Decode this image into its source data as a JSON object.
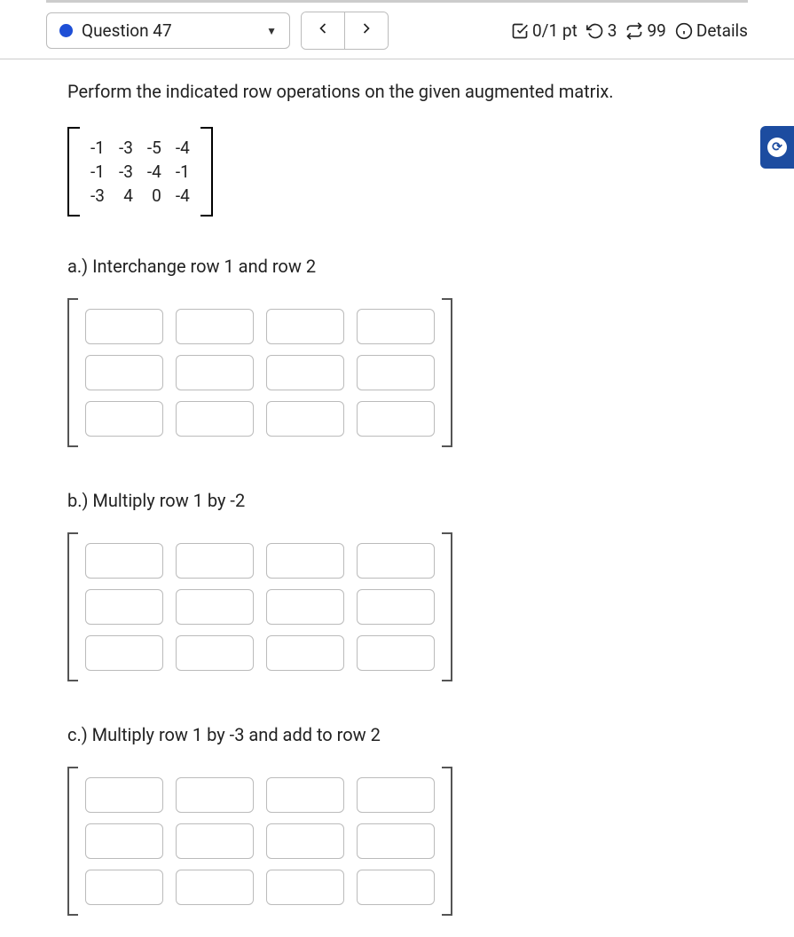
{
  "header": {
    "question_label": "Question 47",
    "score": "0/1 pt",
    "retries": "3",
    "attempts": "99",
    "details_label": "Details"
  },
  "instruction": "Perform the indicated row operations on the given augmented matrix.",
  "matrix": [
    [
      "-1",
      "-3",
      "-5",
      "-4"
    ],
    [
      "-1",
      "-3",
      "-4",
      "-1"
    ],
    [
      "-3",
      "4",
      "0",
      "-4"
    ]
  ],
  "parts": {
    "a": "a.) Interchange row 1 and row 2",
    "b": "b.) Multiply row 1 by -2",
    "c": "c.) Multiply row 1 by -3 and add to row 2"
  }
}
